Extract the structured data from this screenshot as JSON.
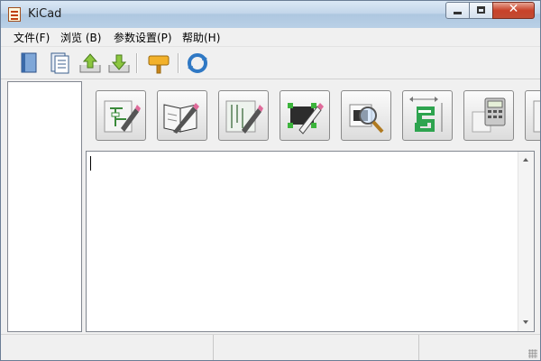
{
  "window": {
    "title": "KiCad"
  },
  "menu": [
    {
      "label": "文件(F)"
    },
    {
      "label": "浏览 (B)"
    },
    {
      "label": "参数设置(P)"
    },
    {
      "label": "帮助(H)"
    }
  ],
  "toolbar": [
    {
      "icon": "new-project-icon"
    },
    {
      "icon": "new-project-from-template-icon"
    },
    {
      "icon": "open-project-icon"
    },
    {
      "icon": "save-project-icon"
    },
    {
      "icon": "archive-project-icon"
    },
    {
      "icon": "refresh-icon"
    }
  ],
  "launchers": [
    {
      "icon": "schematic-editor-icon"
    },
    {
      "icon": "component-library-editor-icon"
    },
    {
      "icon": "pcb-editor-icon"
    },
    {
      "icon": "footprint-editor-icon"
    },
    {
      "icon": "gerber-viewer-icon"
    },
    {
      "icon": "bitmap-to-component-icon"
    },
    {
      "icon": "pcb-calculator-icon"
    },
    {
      "icon": "worksheet-editor-icon"
    }
  ],
  "message_panel": {
    "text": ""
  },
  "status": [
    "",
    "",
    ""
  ],
  "colors": {
    "titlebar": "#c3d6ea",
    "close_button": "#c8422a",
    "panel_border": "#828790"
  }
}
